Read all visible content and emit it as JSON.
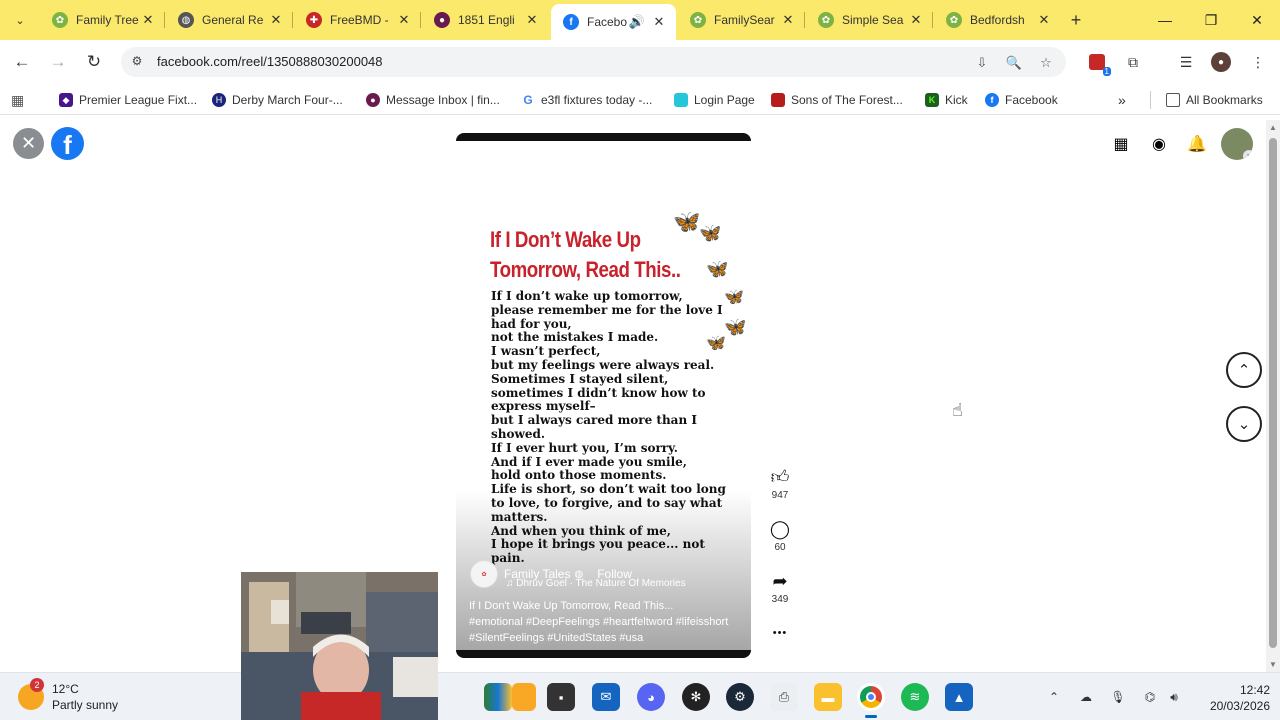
{
  "tabs": [
    {
      "title": "Family Tree",
      "color": "#7cb342",
      "glyph": "🌿",
      "active": false
    },
    {
      "title": "General Re",
      "color": "#555555",
      "glyph": "◍",
      "active": false
    },
    {
      "title": "FreeBMD -",
      "color": "#c62828",
      "glyph": "✚",
      "active": false
    },
    {
      "title": "1851 Engli",
      "color": "#6a1b4d",
      "glyph": "●",
      "active": false
    },
    {
      "title": "Facebo",
      "color": "#1877f2",
      "glyph": "f",
      "active": true
    },
    {
      "title": "FamilySear",
      "color": "#7cb342",
      "glyph": "🌿",
      "active": false
    },
    {
      "title": "Simple Sea",
      "color": "#7cb342",
      "glyph": "🌿",
      "active": false
    },
    {
      "title": "Bedfordsh",
      "color": "#7cb342",
      "glyph": "🌿",
      "active": false
    }
  ],
  "address": {
    "url": "facebook.com/reel/1350888030200048"
  },
  "extension_badge": "1",
  "bookmarks": [
    {
      "label": "Premier League Fixt...",
      "color": "#4a148c",
      "glyph": "◆"
    },
    {
      "label": "Derby March Four-...",
      "color": "#1a237e",
      "glyph": "H"
    },
    {
      "label": "Message Inbox | fin...",
      "color": "#6a1b4d",
      "glyph": "●"
    },
    {
      "label": "e3fl fixtures today -...",
      "color": "#ffffff",
      "glyph": "G"
    },
    {
      "label": "Login Page",
      "color": "#26c6da",
      "glyph": "▭"
    },
    {
      "label": "Sons of The Forest...",
      "color": "#b71c1c",
      "glyph": "■"
    },
    {
      "label": "Kick",
      "color": "#1b5e20",
      "glyph": "K"
    },
    {
      "label": "Facebook",
      "color": "#1877f2",
      "glyph": "f"
    }
  ],
  "all_bookmarks_label": "All Bookmarks",
  "reel": {
    "title_line1": "If I Don’t Wake Up",
    "title_line2": "Tomorrow, Read This..",
    "poem": [
      "If I don’t wake up tomorrow,",
      "please remember me for the love I",
      "had for you,",
      "not the mistakes I made.",
      "I wasn’t perfect,",
      "but my feelings were always real.",
      "Sometimes I stayed silent,",
      "sometimes I didn’t know how to",
      "express myself–",
      "but I always cared more than I",
      "showed.",
      "If I ever hurt you, I’m sorry.",
      "And if I ever made you smile,",
      "hold onto those moments.",
      "Life is short, so don’t wait too long",
      "to love, to forgive, and to say what",
      "matters.",
      "And when you think of me,",
      "I hope it brings you peace... not",
      "pain."
    ],
    "author": "Family Tales",
    "follow": "Follow",
    "music": "♫ Dhruv Goel · The Nature Of Memories",
    "caption": "If I Don't Wake Up Tomorrow, Read This...",
    "hashtags": "#emotional #DeepFeelings #heartfeltword #lifeisshort #SilentFeelings #UnitedStates #usa"
  },
  "actions": {
    "likes": "947",
    "comments": "60",
    "shares": "349",
    "more": "•••"
  },
  "taskbar": {
    "temperature": "12°C",
    "weather": "Partly sunny",
    "weather_badge": "2",
    "time": "12:42",
    "date": "20/03/2026"
  }
}
